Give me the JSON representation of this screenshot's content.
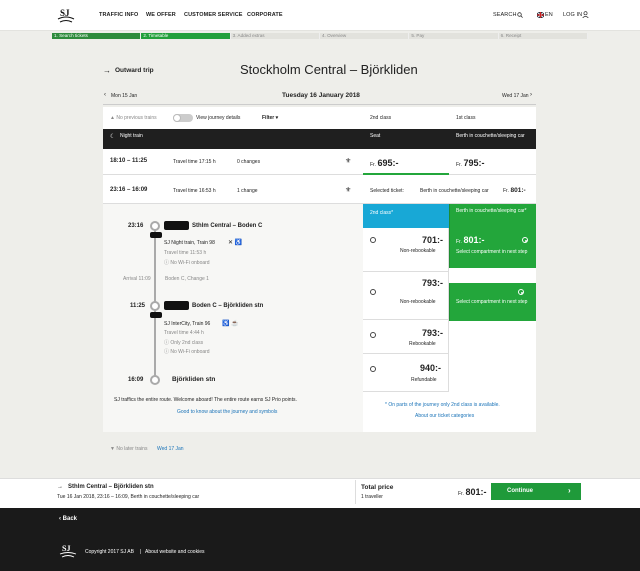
{
  "header": {
    "nav": [
      "TRAFFIC INFO",
      "WE OFFER",
      "CUSTOMER SERVICE",
      "CORPORATE"
    ],
    "search": "SEARCH",
    "lang": "EN",
    "login": "LOG IN"
  },
  "progress": [
    "1. Search tickets",
    "2. Timetable",
    "3. Added extras",
    "4. Overview",
    "5. Pay",
    "6. Receipt"
  ],
  "trip": {
    "label": "Outward trip",
    "title": "Stockholm Central – Björkliden",
    "prev": "Mon 15 Jan",
    "date": "Tuesday 16 January 2018",
    "next": "Wed 17 Jan"
  },
  "controls": {
    "no_prev": "No previous trains",
    "journey_details": "View journey details",
    "filter": "Filter",
    "col_second": "2nd class",
    "col_first": "1st class"
  },
  "table_head": {
    "night": "Night train",
    "seat": "Seat",
    "berth": "Berth in couchette/sleeping car"
  },
  "row1": {
    "time": "18:10 – 11:25",
    "travel": "Travel time 17:15 h",
    "changes": "0 changes",
    "price_seat": "695:-",
    "price_berth": "795:-",
    "fr": "Fr."
  },
  "row2": {
    "time": "23:16 – 16:09",
    "travel": "Travel time 16:53 h",
    "changes": "1 change",
    "selected_label": "Selected ticket:",
    "selected": "Berth in couchette/sleeping car",
    "selected_price": "801:-",
    "fr": "Fr."
  },
  "journey": {
    "t1": "23:16",
    "leg1": "Sthlm Central – Boden C",
    "train1": "SJ Night train, Train 98",
    "tt1": "Travel time 11:53 h",
    "wifi1": "No Wi-Fi onboard",
    "arrival": "Arrival 11:09",
    "change": "Boden C, Change 1",
    "t2": "11:25",
    "leg2": "Boden C – Björkliden stn",
    "train2": "SJ InterCity, Train 96",
    "tt2": "Travel time 4:44 h",
    "only2": "Only 2nd class",
    "wifi2": "No Wi-Fi onboard",
    "t3": "16:09",
    "end": "Björkliden stn",
    "note": "SJ traffics the entire route. Welcome aboard! The entire route earns SJ Prio points.",
    "good": "Good to know about the journey and symbols"
  },
  "options": {
    "second_head": "2nd class*",
    "first_head": "Berth in couchette/sleeping car*",
    "o1": {
      "price": "701:-",
      "cond": "Non-rebookable"
    },
    "o2": {
      "price": "793:-",
      "cond": "Non-rebookable"
    },
    "o3": {
      "price": "793:-",
      "cond": "Rebookable"
    },
    "o4": {
      "price": "940:-",
      "cond": "Refundable"
    },
    "f1": {
      "fr": "Fr.",
      "price": "801:-",
      "note": "Select compartment in next step"
    },
    "f2": {
      "note": "Select compartment in next step"
    },
    "partial": "* On parts of the journey only 2nd class is available.",
    "categories": "About our ticket categories"
  },
  "below": {
    "no_later": "No later trains",
    "next_day": "Wed 17 Jan"
  },
  "summary": {
    "route": "Sthlm Central – Björkliden stn",
    "details": "Tue 16 Jan 2018, 23:16 – 16:09, Berth in couchette/sleeping car",
    "total": "Total price",
    "travellers": "1 traveller",
    "fr": "Fr.",
    "price": "801:-",
    "continue": "Continue"
  },
  "footer": {
    "back": "Back",
    "copyright": "Copyright 2017 SJ AB",
    "about": "About website and cookies"
  }
}
